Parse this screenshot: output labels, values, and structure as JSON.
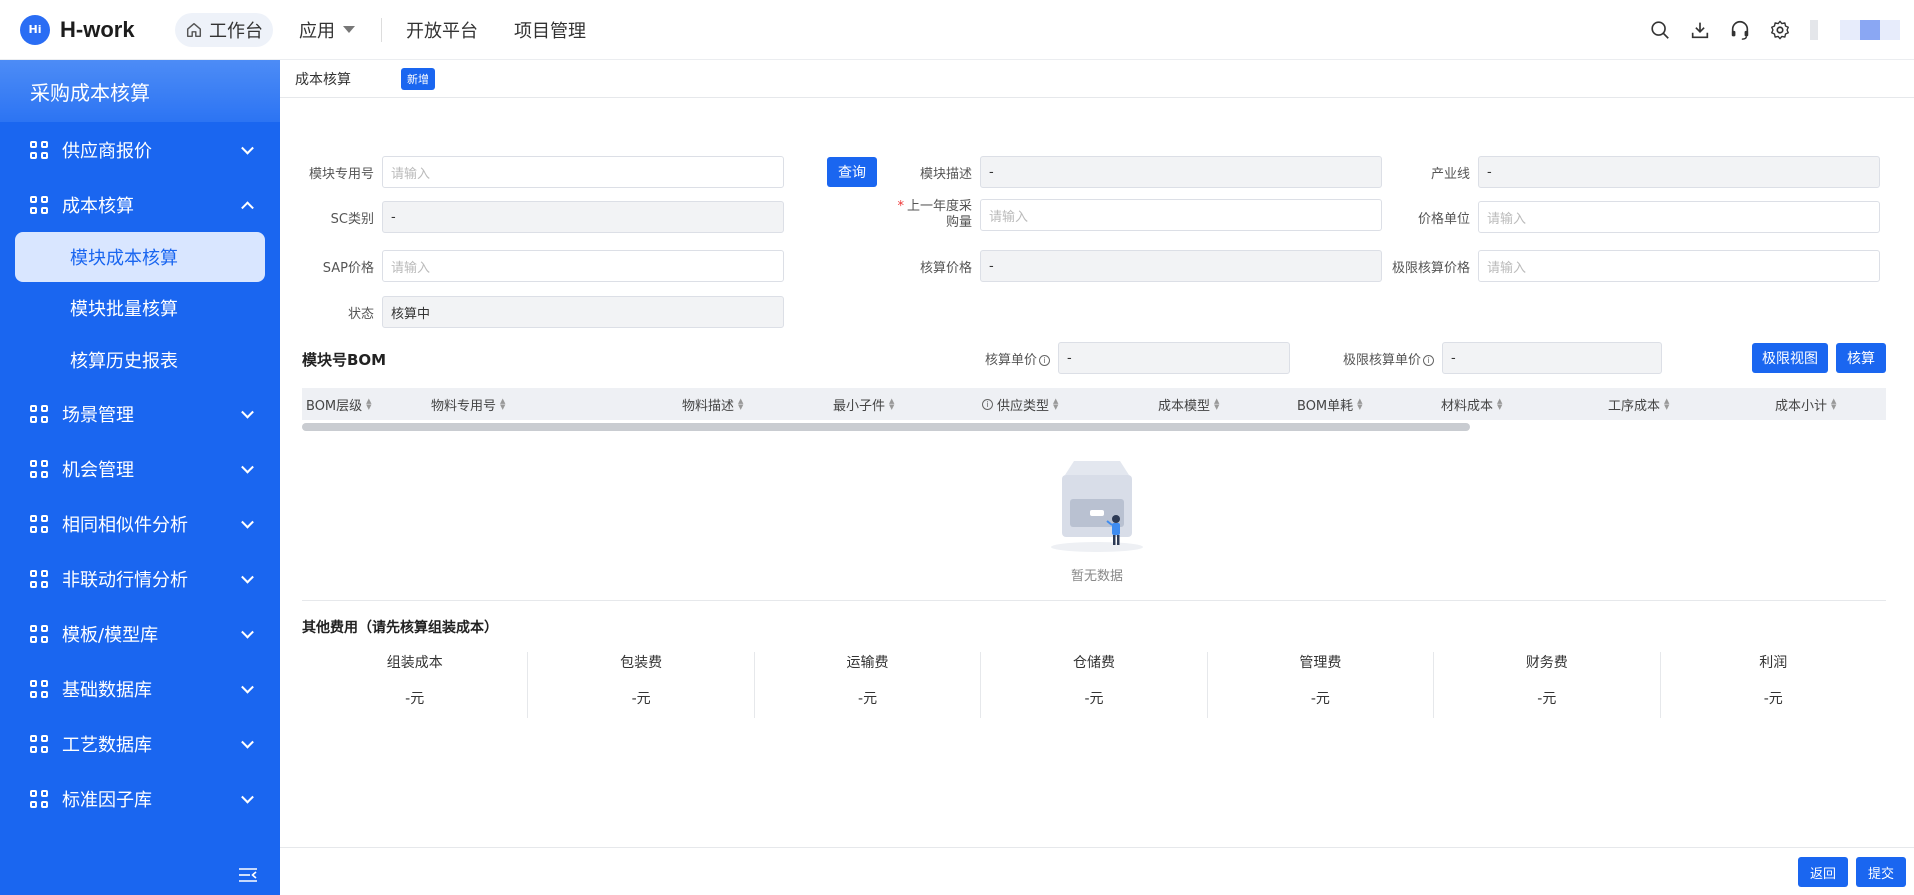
{
  "app": {
    "logo_mark": "Hi",
    "title": "H-work"
  },
  "nav": {
    "workbench": "工作台",
    "apps": "应用",
    "open_platform": "开放平台",
    "project_mgmt": "项目管理"
  },
  "sidebar": {
    "header": "采购成本核算",
    "items": [
      {
        "label": "供应商报价"
      },
      {
        "label": "成本核算"
      },
      {
        "label": "场景管理"
      },
      {
        "label": "机会管理"
      },
      {
        "label": "相同相似件分析"
      },
      {
        "label": "非联动行情分析"
      },
      {
        "label": "模板/模型库"
      },
      {
        "label": "基础数据库"
      },
      {
        "label": "工艺数据库"
      },
      {
        "label": "标准因子库"
      }
    ],
    "sub_items": [
      "模块成本核算",
      "模块批量核算",
      "核算历史报表"
    ]
  },
  "tabs": {
    "current": "成本核算",
    "new_badge": "新增"
  },
  "form": {
    "module_no": {
      "label": "模块专用号",
      "placeholder": "请输入"
    },
    "query_btn": "查询",
    "module_desc": {
      "label": "模块描述",
      "value": "-"
    },
    "product_line": {
      "label": "产业线",
      "value": "-"
    },
    "sc_type": {
      "label": "SC类别",
      "value": "-"
    },
    "last_year_qty": {
      "label_a": "上一年度采",
      "label_b": "购量",
      "placeholder": "请输入"
    },
    "price_unit": {
      "label": "价格单位",
      "placeholder": "请输入"
    },
    "sap_price": {
      "label": "SAP价格",
      "placeholder": "请输入"
    },
    "calc_price": {
      "label": "核算价格",
      "value": "-"
    },
    "limit_price": {
      "label": "极限核算价格",
      "placeholder": "请输入"
    },
    "status": {
      "label": "状态",
      "value": "核算中"
    }
  },
  "bom": {
    "title": "模块号BOM",
    "unit_price": {
      "label": "核算单价",
      "value": "-"
    },
    "limit_unit_price": {
      "label": "极限核算单价",
      "value": "-"
    },
    "btn_limit_view": "极限视图",
    "btn_calc": "核算",
    "columns": [
      "BOM层级",
      "物料专用号",
      "物料描述",
      "最小子件",
      "供应类型",
      "成本模型",
      "BOM单耗",
      "材料成本",
      "工序成本",
      "成本小计"
    ],
    "empty": "暂无数据"
  },
  "other_fees": {
    "title": "其他费用（请先核算组装成本）",
    "items": [
      {
        "name": "组装成本",
        "value": "-元"
      },
      {
        "name": "包装费",
        "value": "-元"
      },
      {
        "name": "运输费",
        "value": "-元"
      },
      {
        "name": "仓储费",
        "value": "-元"
      },
      {
        "name": "管理费",
        "value": "-元"
      },
      {
        "name": "财务费",
        "value": "-元"
      },
      {
        "name": "利润",
        "value": "-元"
      }
    ]
  },
  "footer": {
    "back": "返回",
    "submit": "提交"
  },
  "colors": {
    "primary": "#1a66f0",
    "sidebar": "#1a66f0",
    "selected_bg": "#d9e6ff"
  }
}
